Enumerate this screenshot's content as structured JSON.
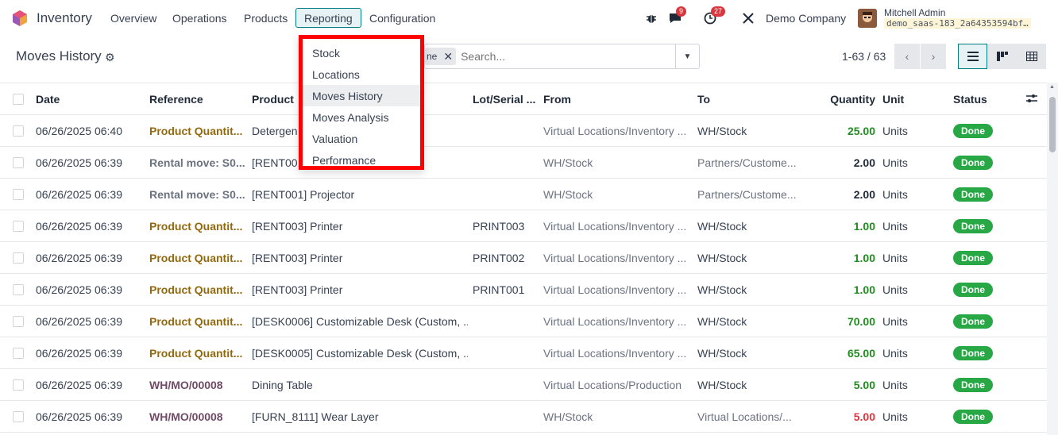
{
  "navbar": {
    "app_name": "Inventory",
    "menus": [
      "Overview",
      "Operations",
      "Products",
      "Reporting",
      "Configuration"
    ],
    "activity_badge": "9",
    "activity_badge_2": "27",
    "company": "Demo Company",
    "user_name": "Mitchell Admin",
    "db_name": "demo_saas-183_2a64353594bf…"
  },
  "control": {
    "title": "Moves History",
    "facet_label": "ne",
    "search_placeholder": "Search...",
    "pager": "1-63 / 63"
  },
  "reporting_menu": [
    "Stock",
    "Locations",
    "Moves History",
    "Moves Analysis",
    "Valuation",
    "Performance"
  ],
  "table": {
    "columns": [
      "Date",
      "Reference",
      "Product",
      "Lot/Serial ...",
      "From",
      "To",
      "Quantity",
      "Unit",
      "Status"
    ],
    "rows": [
      {
        "date": "06/26/2025 06:40",
        "reference": "Product Quantit...",
        "ref_type": "done",
        "product": "Detergen",
        "lot": "",
        "from": "Virtual Locations/Inventory ...",
        "to": "WH/Stock",
        "qty": "25.00",
        "qty_type": "pos",
        "unit": "Units",
        "status": "Done"
      },
      {
        "date": "06/26/2025 06:39",
        "reference": "Rental move: S0...",
        "ref_type": "rental",
        "product": "[RENT001",
        "lot": "",
        "from": "WH/Stock",
        "to": "Partners/Custome...",
        "qty": "2.00",
        "qty_type": "zero",
        "unit": "Units",
        "status": "Done"
      },
      {
        "date": "06/26/2025 06:39",
        "reference": "Rental move: S0...",
        "ref_type": "rental",
        "product": "[RENT001] Projector",
        "lot": "",
        "from": "WH/Stock",
        "to": "Partners/Custome...",
        "qty": "2.00",
        "qty_type": "zero",
        "unit": "Units",
        "status": "Done"
      },
      {
        "date": "06/26/2025 06:39",
        "reference": "Product Quantit...",
        "ref_type": "done",
        "product": "[RENT003] Printer",
        "lot": "PRINT003",
        "from": "Virtual Locations/Inventory ...",
        "to": "WH/Stock",
        "qty": "1.00",
        "qty_type": "pos",
        "unit": "Units",
        "status": "Done"
      },
      {
        "date": "06/26/2025 06:39",
        "reference": "Product Quantit...",
        "ref_type": "done",
        "product": "[RENT003] Printer",
        "lot": "PRINT002",
        "from": "Virtual Locations/Inventory ...",
        "to": "WH/Stock",
        "qty": "1.00",
        "qty_type": "pos",
        "unit": "Units",
        "status": "Done"
      },
      {
        "date": "06/26/2025 06:39",
        "reference": "Product Quantit...",
        "ref_type": "done",
        "product": "[RENT003] Printer",
        "lot": "PRINT001",
        "from": "Virtual Locations/Inventory ...",
        "to": "WH/Stock",
        "qty": "1.00",
        "qty_type": "pos",
        "unit": "Units",
        "status": "Done"
      },
      {
        "date": "06/26/2025 06:39",
        "reference": "Product Quantit...",
        "ref_type": "done",
        "product": "[DESK0006] Customizable Desk (Custom, ...",
        "lot": "",
        "from": "Virtual Locations/Inventory ...",
        "to": "WH/Stock",
        "qty": "70.00",
        "qty_type": "pos",
        "unit": "Units",
        "status": "Done"
      },
      {
        "date": "06/26/2025 06:39",
        "reference": "Product Quantit...",
        "ref_type": "done",
        "product": "[DESK0005] Customizable Desk (Custom, ...",
        "lot": "",
        "from": "Virtual Locations/Inventory ...",
        "to": "WH/Stock",
        "qty": "65.00",
        "qty_type": "pos",
        "unit": "Units",
        "status": "Done"
      },
      {
        "date": "06/26/2025 06:39",
        "reference": "WH/MO/00008",
        "ref_type": "mo",
        "product": "Dining Table",
        "lot": "",
        "from": "Virtual Locations/Production",
        "to": "WH/Stock",
        "qty": "5.00",
        "qty_type": "pos",
        "unit": "Units",
        "status": "Done"
      },
      {
        "date": "06/26/2025 06:39",
        "reference": "WH/MO/00008",
        "ref_type": "mo",
        "product": "[FURN_8111] Wear Layer",
        "lot": "",
        "from": "WH/Stock",
        "to": "Virtual Locations/...",
        "qty": "5.00",
        "qty_type": "neg",
        "unit": "Units",
        "status": "Done"
      }
    ]
  },
  "colors": {
    "accent": "#017e84",
    "done_badge": "#28a745",
    "highlight_border": "#ff0000"
  }
}
